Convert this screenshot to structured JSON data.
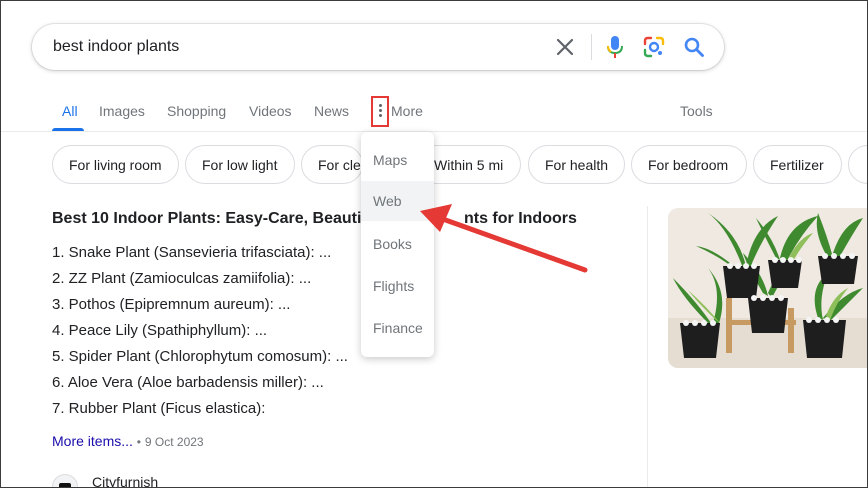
{
  "search": {
    "query": "best indoor plants"
  },
  "tabs": [
    {
      "label": "All",
      "active": true
    },
    {
      "label": "Images"
    },
    {
      "label": "Shopping"
    },
    {
      "label": "Videos"
    },
    {
      "label": "News"
    },
    {
      "label": "More"
    }
  ],
  "tools_label": "Tools",
  "chips": [
    "For living room",
    "For low light",
    "For cle",
    "Within 5 mi",
    "For health",
    "For bedroom",
    "Fertilizer"
  ],
  "more_menu": {
    "items": [
      "Maps",
      "Web",
      "Books",
      "Flights",
      "Finance"
    ],
    "highlighted": "Web"
  },
  "result": {
    "title": "Best 10 Indoor Plants: Easy-Care, Beautiful",
    "title_tail": "nts for Indoors",
    "items": [
      "1. Snake Plant (Sansevieria trifasciata): ...",
      "2. ZZ Plant (Zamioculcas zamiifolia): ...",
      "3. Pothos (Epipremnum aureum): ...",
      "4. Peace Lily (Spathiphyllum): ...",
      "5. Spider Plant (Chlorophytum comosum): ...",
      "6. Aloe Vera (Aloe barbadensis miller): ...",
      "7. Rubber Plant (Ficus elastica):"
    ],
    "more_items": "More items...",
    "separator": "•",
    "date": "9 Oct 2023",
    "source": "Cityfurnish"
  },
  "colors": {
    "accent": "#1a73e8",
    "annotation": "#e53935",
    "link": "#1a0dab"
  }
}
